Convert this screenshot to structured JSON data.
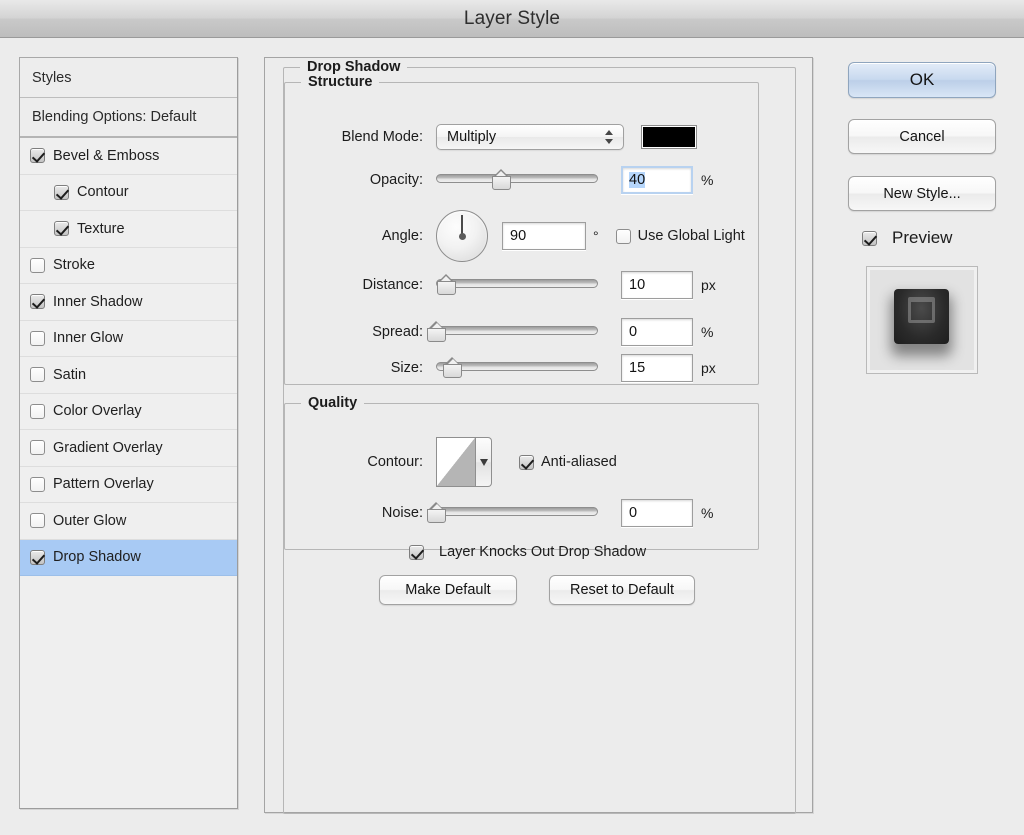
{
  "window": {
    "title": "Layer Style"
  },
  "sidebar": {
    "header": "Styles",
    "blending_options": "Blending Options: Default",
    "items": [
      {
        "label": "Bevel & Emboss",
        "checked": true,
        "indent": false,
        "selected": false
      },
      {
        "label": "Contour",
        "checked": true,
        "indent": true,
        "selected": false
      },
      {
        "label": "Texture",
        "checked": true,
        "indent": true,
        "selected": false
      },
      {
        "label": "Stroke",
        "checked": false,
        "indent": false,
        "selected": false
      },
      {
        "label": "Inner Shadow",
        "checked": true,
        "indent": false,
        "selected": false
      },
      {
        "label": "Inner Glow",
        "checked": false,
        "indent": false,
        "selected": false
      },
      {
        "label": "Satin",
        "checked": false,
        "indent": false,
        "selected": false
      },
      {
        "label": "Color Overlay",
        "checked": false,
        "indent": false,
        "selected": false
      },
      {
        "label": "Gradient Overlay",
        "checked": false,
        "indent": false,
        "selected": false
      },
      {
        "label": "Pattern Overlay",
        "checked": false,
        "indent": false,
        "selected": false
      },
      {
        "label": "Outer Glow",
        "checked": false,
        "indent": false,
        "selected": false
      },
      {
        "label": "Drop Shadow",
        "checked": true,
        "indent": false,
        "selected": true
      }
    ],
    "selected_highlight_color": "#a8caf4"
  },
  "main": {
    "group_title": "Drop Shadow",
    "structure": {
      "title": "Structure",
      "blend_mode": {
        "label": "Blend Mode:",
        "value": "Multiply"
      },
      "shadow_color": "#000000",
      "opacity": {
        "label": "Opacity:",
        "value": "40",
        "unit": "%",
        "slider_pct": 40
      },
      "angle": {
        "label": "Angle:",
        "value": "90",
        "unit": "°",
        "dial_degrees": 90
      },
      "use_global_light": {
        "label": "Use Global Light",
        "checked": false
      },
      "distance": {
        "label": "Distance:",
        "value": "10",
        "unit": "px",
        "slider_pct": 6
      },
      "spread": {
        "label": "Spread:",
        "value": "0",
        "unit": "%",
        "slider_pct": 0
      },
      "size": {
        "label": "Size:",
        "value": "15",
        "unit": "px",
        "slider_pct": 10
      }
    },
    "quality": {
      "title": "Quality",
      "contour": {
        "label": "Contour:"
      },
      "anti_aliased": {
        "label": "Anti-aliased",
        "checked": true
      },
      "noise": {
        "label": "Noise:",
        "value": "0",
        "unit": "%",
        "slider_pct": 0
      }
    },
    "layer_knocks_out": {
      "label": "Layer Knocks Out Drop Shadow",
      "checked": true
    },
    "make_default": "Make Default",
    "reset_to_default": "Reset to Default"
  },
  "actions": {
    "ok": "OK",
    "cancel": "Cancel",
    "new_style": "New Style...",
    "preview": {
      "label": "Preview",
      "checked": true
    }
  }
}
